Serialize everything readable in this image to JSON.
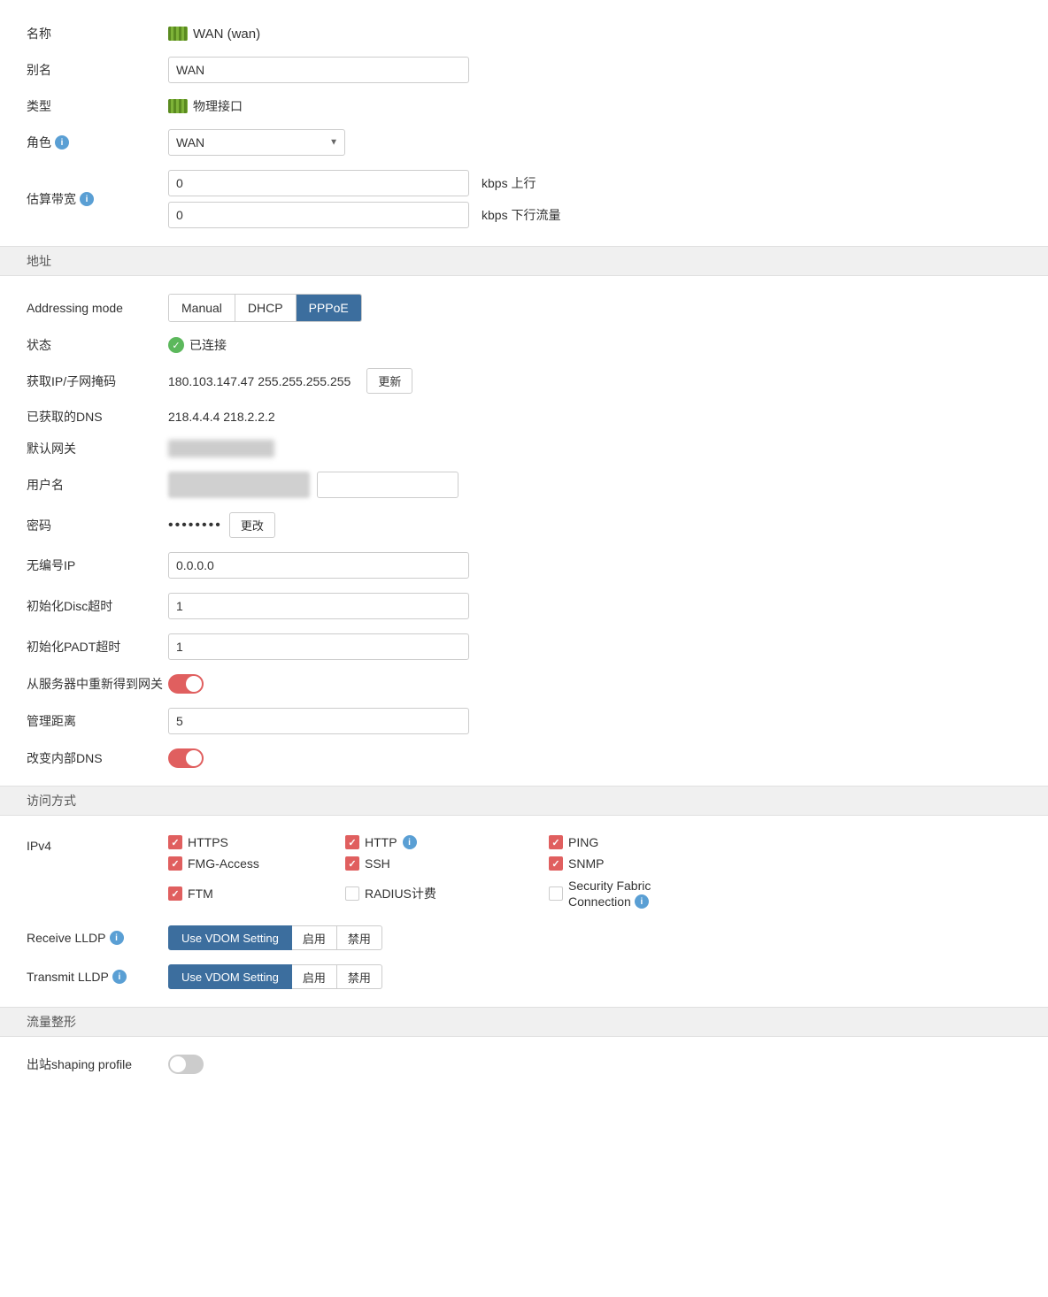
{
  "interface": {
    "name_label": "名称",
    "interface_name": "WAN (wan)",
    "alias_label": "别名",
    "alias_value": "WAN",
    "type_label": "类型",
    "type_value": "物理接口",
    "role_label": "角色",
    "role_value": "WAN",
    "bandwidth_label": "估算带宽",
    "bandwidth_upstream": "0",
    "bandwidth_downstream": "0",
    "kbps_upstream": "kbps 上行",
    "kbps_downstream": "kbps 下行流量"
  },
  "address_section": {
    "title": "地址",
    "mode_label": "Addressing mode",
    "mode_manual": "Manual",
    "mode_dhcp": "DHCP",
    "mode_pppoe": "PPPoE",
    "status_label": "状态",
    "status_value": "已连接",
    "ip_label": "获取IP/子网掩码",
    "ip_value": "180.103.147.47 255.255.255.255",
    "update_btn": "更新",
    "dns_label": "已获取的DNS",
    "dns_value": "218.4.4.4  218.2.2.2",
    "gateway_label": "默认网关",
    "username_label": "用户名",
    "password_label": "密码",
    "password_dots": "••••••••",
    "change_btn": "更改",
    "unnumbered_label": "无编号IP",
    "unnumbered_value": "0.0.0.0",
    "disc_timeout_label": "初始化Disc超时",
    "disc_timeout_value": "1",
    "padt_timeout_label": "初始化PADT超时",
    "padt_timeout_value": "1",
    "retrieve_gateway_label": "从服务器中重新得到网关",
    "admin_distance_label": "管理距离",
    "admin_distance_value": "5",
    "change_dns_label": "改变内部DNS"
  },
  "access_section": {
    "title": "访问方式",
    "ipv4_label": "IPv4",
    "checkboxes": [
      {
        "id": "https",
        "label": "HTTPS",
        "checked": true,
        "has_info": false
      },
      {
        "id": "http",
        "label": "HTTP",
        "checked": true,
        "has_info": true
      },
      {
        "id": "ping",
        "label": "PING",
        "checked": true,
        "has_info": false
      },
      {
        "id": "fmg",
        "label": "FMG-Access",
        "checked": true,
        "has_info": false
      },
      {
        "id": "ssh",
        "label": "SSH",
        "checked": true,
        "has_info": false
      },
      {
        "id": "snmp",
        "label": "SNMP",
        "checked": true,
        "has_info": false
      },
      {
        "id": "ftm",
        "label": "FTM",
        "checked": true,
        "has_info": false
      },
      {
        "id": "radius",
        "label": "RADIUS计费",
        "checked": false,
        "has_info": false
      },
      {
        "id": "security_fabric",
        "label": "Security Fabric\nConnection",
        "checked": false,
        "has_info": true
      }
    ],
    "receive_lldp_label": "Receive LLDP",
    "transmit_lldp_label": "Transmit LLDP",
    "use_vdom": "Use VDOM Setting",
    "enable": "启用",
    "disable": "禁用"
  },
  "traffic_section": {
    "title": "流量整形",
    "outbound_label": "出站shaping profile"
  }
}
